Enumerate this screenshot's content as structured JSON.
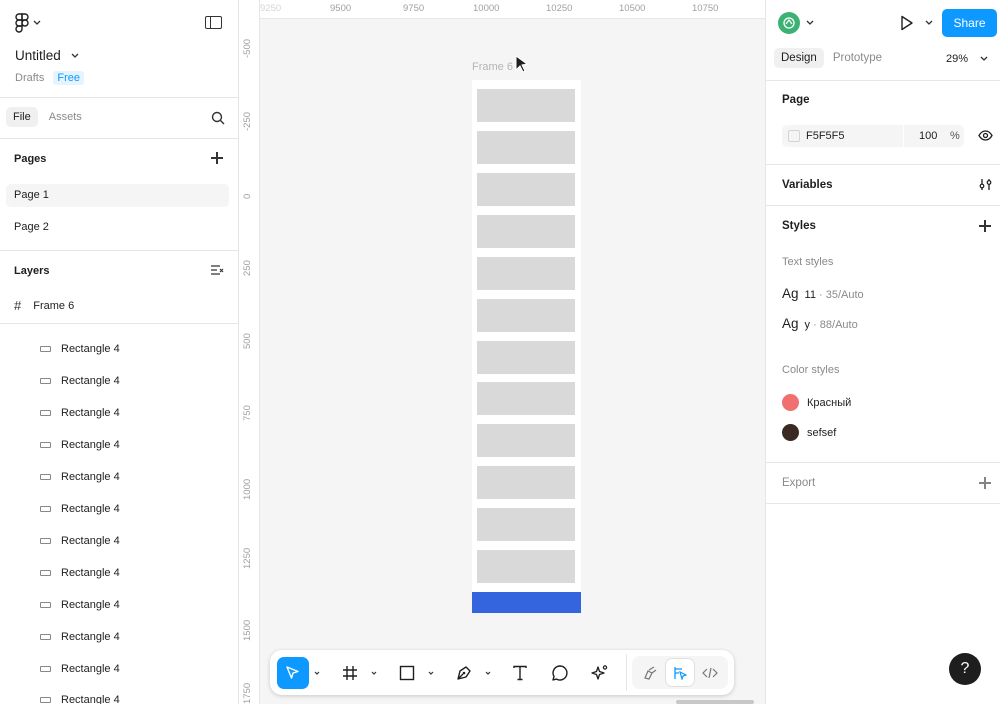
{
  "left_panel": {
    "file_title": "Untitled",
    "drafts_label": "Drafts",
    "plan_badge": "Free",
    "tabs": [
      {
        "label": "File"
      },
      {
        "label": "Assets"
      }
    ],
    "pages_header": "Pages",
    "pages": [
      {
        "label": "Page 1"
      },
      {
        "label": "Page 2"
      }
    ],
    "layers_header": "Layers",
    "frame_layer": "Frame 6",
    "layers": [
      {
        "label": "Rectangle 4"
      },
      {
        "label": "Rectangle 4"
      },
      {
        "label": "Rectangle 4"
      },
      {
        "label": "Rectangle 4"
      },
      {
        "label": "Rectangle 4"
      },
      {
        "label": "Rectangle 4"
      },
      {
        "label": "Rectangle 4"
      },
      {
        "label": "Rectangle 4"
      },
      {
        "label": "Rectangle 4"
      },
      {
        "label": "Rectangle 4"
      },
      {
        "label": "Rectangle 4"
      },
      {
        "label": "Rectangle 4"
      }
    ]
  },
  "canvas": {
    "ruler_top": [
      "9250",
      "9500",
      "9750",
      "10000",
      "10250",
      "10500",
      "10750"
    ],
    "ruler_left": [
      "-500",
      "-250",
      "0",
      "250",
      "500",
      "750",
      "1000",
      "1250",
      "1500",
      "1750"
    ],
    "frame_label": "Frame 6",
    "rectangle_count": 12,
    "bar_color": "#3565de"
  },
  "toolbar": {
    "tools": [
      "move-tool",
      "frame-tool",
      "shape-tool",
      "pen-tool",
      "text-tool",
      "comment-tool",
      "actions-tool"
    ],
    "modes": [
      "draw-mode",
      "design-mode",
      "dev-mode"
    ]
  },
  "right_panel": {
    "share_label": "Share",
    "tabs": [
      {
        "label": "Design"
      },
      {
        "label": "Prototype"
      }
    ],
    "zoom": "29%",
    "page_section": "Page",
    "page_color": "F5F5F5",
    "page_opacity": "100",
    "page_opacity_unit": "%",
    "variables_section": "Variables",
    "styles_section": "Styles",
    "text_styles_header": "Text styles",
    "text_styles": [
      {
        "sample": "Ag",
        "name": "11",
        "meta": " · 35/Auto"
      },
      {
        "sample": "Ag",
        "name": "y",
        "meta": " · 88/Auto"
      }
    ],
    "color_styles_header": "Color styles",
    "color_styles": [
      {
        "name": "Красный",
        "color": "#f07070"
      },
      {
        "name": "sefsef",
        "color": "#3a2a24"
      }
    ],
    "export_section": "Export"
  },
  "help_label": "?",
  "colors": {
    "accent": "#0d99ff"
  }
}
